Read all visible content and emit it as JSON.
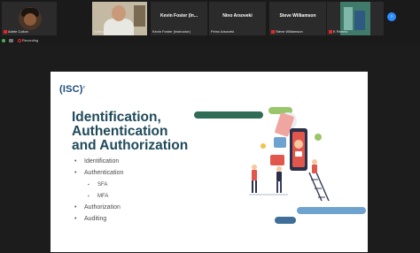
{
  "participants": [
    {
      "name": "Adele Colton",
      "muted": true
    },
    {
      "name": "Kathlyn Rosgo",
      "muted": false
    },
    {
      "display_name": "Kevin Foster (In...",
      "name": "Kevin Foster (Instructor)",
      "muted": false
    },
    {
      "display_name": "Nino Arsoveki",
      "name": "Pelnc Arsoveki",
      "muted": false
    },
    {
      "display_name": "Steve Williamson",
      "name": "Steve Williamson",
      "muted": true
    },
    {
      "name": "K Renew",
      "muted": true
    }
  ],
  "next_icon": "chevron-right-icon",
  "recording": {
    "label": "Recording"
  },
  "slide": {
    "logo": "(ISC)",
    "logo_mark": "2",
    "title_lines": [
      "Identification,",
      "Authentication",
      "and Authorization"
    ],
    "bullets": [
      "Identification",
      "Authentication",
      "SFA",
      "MFA",
      "Authorization",
      "Auditing"
    ],
    "colors": {
      "title": "#1f4a5a",
      "green_bar": "#2f6b55",
      "light_green_bar": "#9bc56a",
      "blue_bar": "#6fa3cf",
      "dark_blue_bar": "#3f6f98"
    }
  }
}
